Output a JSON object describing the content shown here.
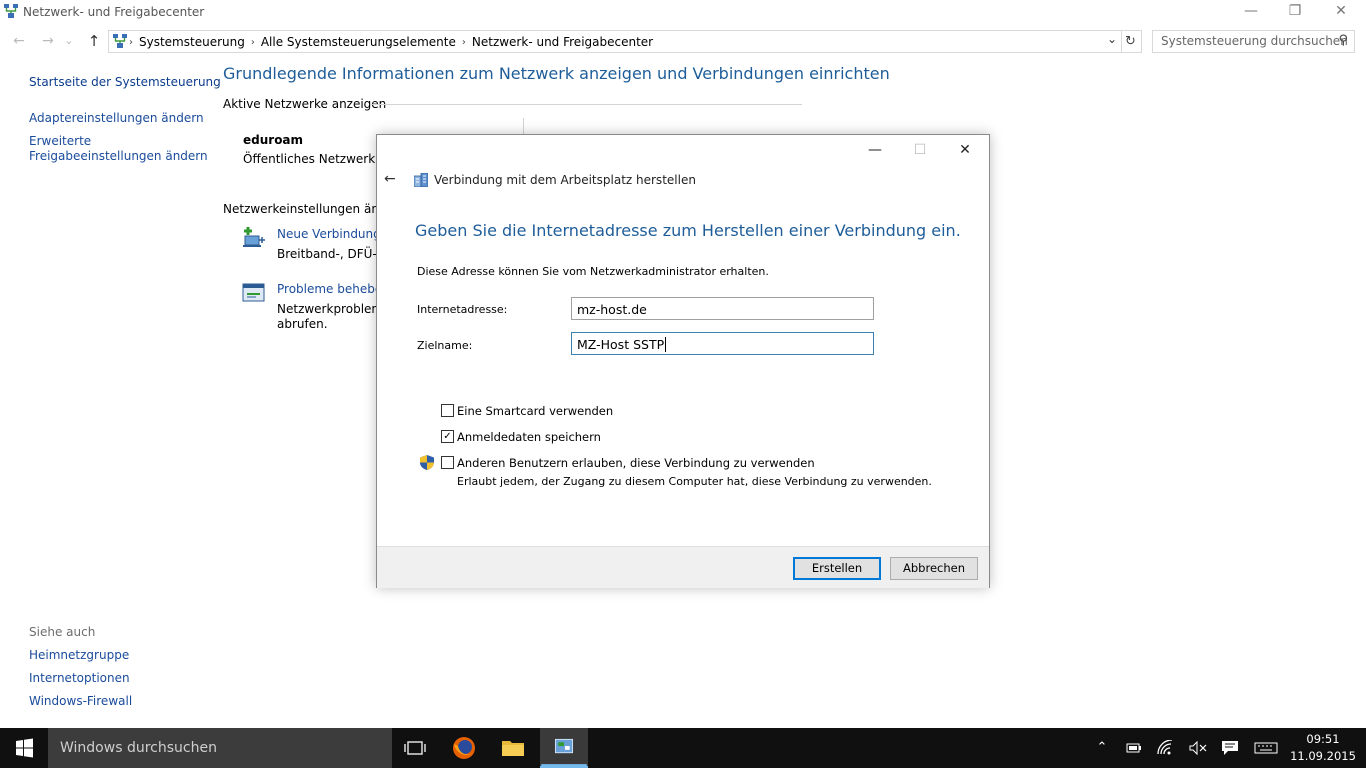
{
  "window": {
    "title": "Netzwerk- und Freigabecenter",
    "minimize_glyph": "—",
    "restore_glyph": "❐",
    "close_glyph": "✕"
  },
  "nav": {
    "back_glyph": "←",
    "forward_glyph": "→",
    "recent_glyph": "⌄",
    "up_glyph": "↑"
  },
  "addressbar": {
    "crumbs": [
      "Systemsteuerung",
      "Alle Systemsteuerungselemente",
      "Netzwerk- und Freigabecenter"
    ],
    "separator": "›",
    "dropdown_glyph": "⌄",
    "refresh_glyph": "↻"
  },
  "search": {
    "placeholder": "Systemsteuerung durchsuchen",
    "icon_glyph": "⚲"
  },
  "sidebar": {
    "home": "Startseite der Systemsteuerung",
    "adapter": "Adaptereinstellungen ändern",
    "advanced_line1": "Erweiterte",
    "advanced_line2": "Freigabeeinstellungen ändern",
    "see_also": "Siehe auch",
    "links": [
      "Heimnetzgruppe",
      "Internetoptionen",
      "Windows-Firewall"
    ]
  },
  "main": {
    "title": "Grundlegende Informationen zum Netzwerk anzeigen und Verbindungen einrichten",
    "active_networks_label": "Aktive Netzwerke anzeigen",
    "network_name": "eduroam",
    "network_type": "Öffentliches Netzwerk",
    "settings_label": "Netzwerkeinstellungen änder",
    "tasks": [
      {
        "link": "Neue Verbindung o",
        "desc1": "Breitband-, DFÜ- o",
        "desc2": ""
      },
      {
        "link": "Probleme beheben",
        "desc1": "Netzwerkprobleme",
        "desc2": "abrufen."
      }
    ]
  },
  "dialog": {
    "minimize_glyph": "—",
    "maximize_glyph": "☐",
    "close_glyph": "✕",
    "back_glyph": "←",
    "title": "Verbindung mit dem Arbeitsplatz herstellen",
    "heading": "Geben Sie die Internetadresse zum Herstellen einer Verbindung ein.",
    "info": "Diese Adresse können Sie vom Netzwerkadministrator erhalten.",
    "address_label": "Internetadresse:",
    "address_value": "mz-host.de",
    "target_label": "Zielname:",
    "target_value": "MZ-Host SSTP",
    "checkboxes": [
      {
        "label": "Eine Smartcard verwenden",
        "checked": false,
        "mark": ""
      },
      {
        "label": "Anmeldedaten speichern",
        "checked": true,
        "mark": "✓"
      },
      {
        "label": "Anderen Benutzern erlauben, diese Verbindung zu verwenden",
        "checked": false,
        "mark": ""
      }
    ],
    "allow_hint": "Erlaubt jedem, der Zugang zu diesem Computer hat, diese Verbindung zu verwenden.",
    "create_button": "Erstellen",
    "cancel_button": "Abbrechen"
  },
  "taskbar": {
    "search_placeholder": "Windows durchsuchen",
    "time": "09:51",
    "date": "11.09.2015",
    "tray_icons": [
      "chevron-up-icon",
      "battery-icon",
      "wifi-icon",
      "speaker-muted-icon",
      "notifications-icon",
      "keyboard-icon"
    ]
  },
  "colors": {
    "heading_blue": "#1e5d99",
    "link_blue": "#1a4b9b",
    "taskbar": "#101010",
    "accent": "#0078d7"
  }
}
